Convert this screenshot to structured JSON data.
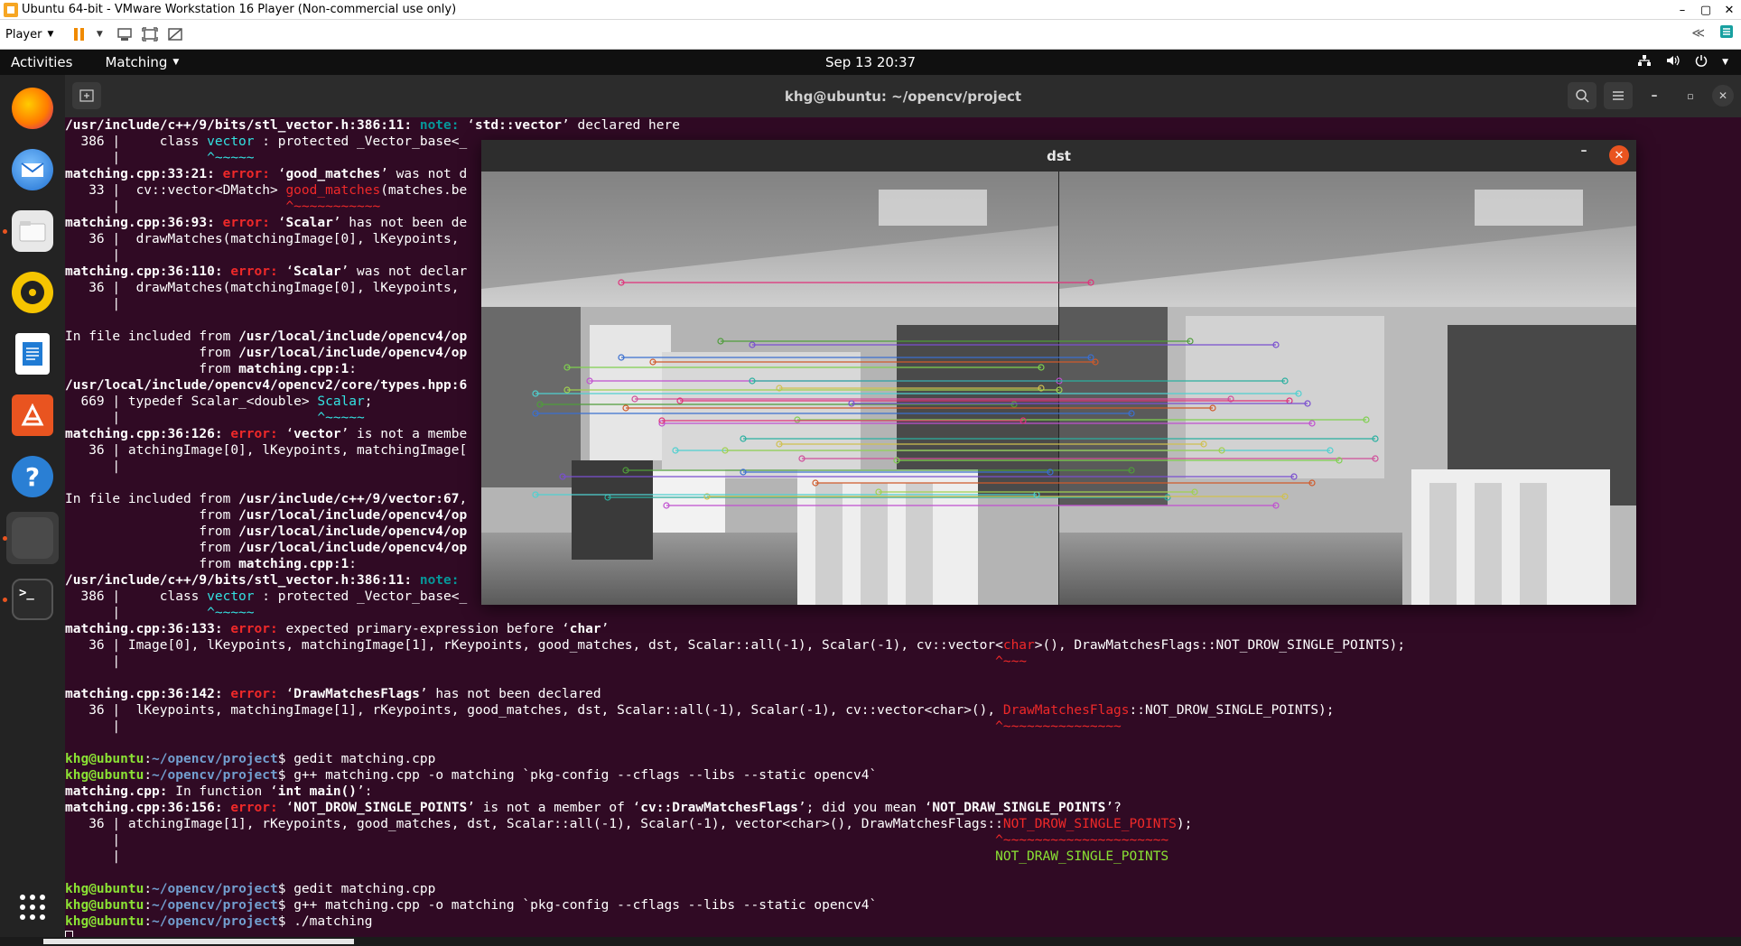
{
  "vm_window": {
    "title": "Ubuntu 64-bit - VMware Workstation 16 Player (Non-commercial use only)",
    "controls": {
      "minimize": "–",
      "restore": "▢",
      "close": "✕"
    }
  },
  "vm_toolbar": {
    "player_label": "Player"
  },
  "topbar": {
    "activities": "Activities",
    "app_menu": "Matching",
    "clock": "Sep 13  20:37"
  },
  "dock": {
    "items": [
      {
        "name": "Firefox",
        "icon": "firefox-icon",
        "color": "#e66000"
      },
      {
        "name": "Thunderbird",
        "icon": "thunderbird-icon",
        "color": "#2a7fd4"
      },
      {
        "name": "Files",
        "icon": "files-icon",
        "color": "#d6d6d6"
      },
      {
        "name": "Rhythmbox",
        "icon": "rhythmbox-icon",
        "color": "#f5c400"
      },
      {
        "name": "LibreOffice Writer",
        "icon": "writer-icon",
        "color": "#1f7bd4"
      },
      {
        "name": "Ubuntu Software",
        "icon": "software-icon",
        "color": "#e95420"
      },
      {
        "name": "Help",
        "icon": "help-icon",
        "color": "#2a7fd4"
      },
      {
        "name": "Matching",
        "icon": "matching-app-icon",
        "color": "#3c3c3c"
      },
      {
        "name": "Terminal",
        "icon": "terminal-icon",
        "color": "#2c2c2c"
      }
    ],
    "show_apps": "show-applications-icon"
  },
  "terminal": {
    "title": "khg@ubuntu: ~/opencv/project",
    "lines": [
      [
        {
          "t": "/usr/include/c++/9/bits/stl_vector.h:386:11: ",
          "c": "b"
        },
        {
          "t": "note: ",
          "c": "note"
        },
        {
          "t": "‘",
          "c": ""
        },
        {
          "t": "std::vector",
          "c": "b"
        },
        {
          "t": "’ declared here",
          "c": ""
        }
      ],
      [
        {
          "t": "  386 |     class ",
          "c": ""
        },
        {
          "t": "vector",
          "c": "cy"
        },
        {
          "t": " : protected _Vector_base<_",
          "c": ""
        }
      ],
      [
        {
          "t": "      |           ",
          "c": ""
        },
        {
          "t": "^~~~~~",
          "c": "cy"
        }
      ],
      [
        {
          "t": "matching.cpp:33:21: ",
          "c": "b"
        },
        {
          "t": "error: ",
          "c": "err"
        },
        {
          "t": "‘",
          "c": ""
        },
        {
          "t": "good_matches",
          "c": "b"
        },
        {
          "t": "’ was not d",
          "c": ""
        }
      ],
      [
        {
          "t": "   33 |  cv::vector<DMatch> ",
          "c": ""
        },
        {
          "t": "good_matches",
          "c": "red"
        },
        {
          "t": "(matches.be",
          "c": ""
        }
      ],
      [
        {
          "t": "      |                     ",
          "c": ""
        },
        {
          "t": "^~~~~~~~~~~~",
          "c": "red"
        }
      ],
      [
        {
          "t": "matching.cpp:36:93: ",
          "c": "b"
        },
        {
          "t": "error: ",
          "c": "err"
        },
        {
          "t": "‘",
          "c": ""
        },
        {
          "t": "Scalar",
          "c": "b"
        },
        {
          "t": "’ has not been de",
          "c": ""
        }
      ],
      [
        {
          "t": "   36 |  drawMatches(matchingImage[0], lKeypoints,",
          "c": ""
        }
      ],
      [
        {
          "t": "      |",
          "c": ""
        }
      ],
      [
        {
          "t": "matching.cpp:36:110: ",
          "c": "b"
        },
        {
          "t": "error: ",
          "c": "err"
        },
        {
          "t": "‘",
          "c": ""
        },
        {
          "t": "Scalar",
          "c": "b"
        },
        {
          "t": "’ was not declar",
          "c": ""
        }
      ],
      [
        {
          "t": "   36 |  drawMatches(matchingImage[0], lKeypoints,",
          "c": ""
        }
      ],
      [
        {
          "t": "      |",
          "c": ""
        }
      ],
      [
        {
          "t": "",
          "c": ""
        }
      ],
      [
        {
          "t": "In file included from ",
          "c": ""
        },
        {
          "t": "/usr/local/include/opencv4/op",
          "c": "b"
        }
      ],
      [
        {
          "t": "                 from ",
          "c": ""
        },
        {
          "t": "/usr/local/include/opencv4/op",
          "c": "b"
        }
      ],
      [
        {
          "t": "                 from ",
          "c": ""
        },
        {
          "t": "matching.cpp:1",
          "c": "b"
        },
        {
          "t": ":",
          "c": ""
        }
      ],
      [
        {
          "t": "/usr/local/include/opencv4/opencv2/core/types.hpp:6",
          "c": "b"
        }
      ],
      [
        {
          "t": "  669 | typedef Scalar_<double> ",
          "c": ""
        },
        {
          "t": "Scalar",
          "c": "cy"
        },
        {
          "t": ";",
          "c": ""
        }
      ],
      [
        {
          "t": "      |                         ",
          "c": ""
        },
        {
          "t": "^~~~~~",
          "c": "cy"
        }
      ],
      [
        {
          "t": "matching.cpp:36:126: ",
          "c": "b"
        },
        {
          "t": "error: ",
          "c": "err"
        },
        {
          "t": "‘",
          "c": ""
        },
        {
          "t": "vector",
          "c": "b"
        },
        {
          "t": "’ is not a membe",
          "c": ""
        }
      ],
      [
        {
          "t": "   36 | atchingImage[0], lKeypoints, matchingImage[",
          "c": ""
        }
      ],
      [
        {
          "t": "      |",
          "c": ""
        }
      ],
      [
        {
          "t": "",
          "c": ""
        }
      ],
      [
        {
          "t": "In file included from ",
          "c": ""
        },
        {
          "t": "/usr/include/c++/9/vector:67",
          "c": "b"
        },
        {
          "t": ",",
          "c": ""
        }
      ],
      [
        {
          "t": "                 from ",
          "c": ""
        },
        {
          "t": "/usr/local/include/opencv4/op",
          "c": "b"
        }
      ],
      [
        {
          "t": "                 from ",
          "c": ""
        },
        {
          "t": "/usr/local/include/opencv4/op",
          "c": "b"
        }
      ],
      [
        {
          "t": "                 from ",
          "c": ""
        },
        {
          "t": "/usr/local/include/opencv4/op",
          "c": "b"
        }
      ],
      [
        {
          "t": "                 from ",
          "c": ""
        },
        {
          "t": "matching.cpp:1",
          "c": "b"
        },
        {
          "t": ":",
          "c": ""
        }
      ],
      [
        {
          "t": "/usr/include/c++/9/bits/stl_vector.h:386:11: ",
          "c": "b"
        },
        {
          "t": "note: ",
          "c": "note"
        }
      ],
      [
        {
          "t": "  386 |     class ",
          "c": ""
        },
        {
          "t": "vector",
          "c": "cy"
        },
        {
          "t": " : protected _Vector_base<_",
          "c": ""
        }
      ],
      [
        {
          "t": "      |           ",
          "c": ""
        },
        {
          "t": "^~~~~~",
          "c": "cy"
        }
      ],
      [
        {
          "t": "matching.cpp:36:133: ",
          "c": "b"
        },
        {
          "t": "error: ",
          "c": "err"
        },
        {
          "t": "expected primary-expression before ‘",
          "c": ""
        },
        {
          "t": "char",
          "c": "b"
        },
        {
          "t": "’",
          "c": ""
        }
      ],
      [
        {
          "t": "   36 | Image[0], lKeypoints, matchingImage[1], rKeypoints, good_matches, dst, Scalar::all(-1), Scalar(-1), cv::vector<",
          "c": ""
        },
        {
          "t": "char",
          "c": "red"
        },
        {
          "t": ">(), DrawMatchesFlags::NOT_DROW_SINGLE_POINTS);",
          "c": ""
        }
      ],
      [
        {
          "t": "      |                                                                                                               ",
          "c": ""
        },
        {
          "t": "^~~~",
          "c": "red"
        }
      ],
      [
        {
          "t": "",
          "c": ""
        }
      ],
      [
        {
          "t": "matching.cpp:36:142: ",
          "c": "b"
        },
        {
          "t": "error: ",
          "c": "err"
        },
        {
          "t": "‘",
          "c": ""
        },
        {
          "t": "DrawMatchesFlags",
          "c": "b"
        },
        {
          "t": "’ has not been declared",
          "c": ""
        }
      ],
      [
        {
          "t": "   36 |  lKeypoints, matchingImage[1], rKeypoints, good_matches, dst, Scalar::all(-1), Scalar(-1), cv::vector<char>(), ",
          "c": ""
        },
        {
          "t": "DrawMatchesFlags",
          "c": "red"
        },
        {
          "t": "::NOT_DROW_SINGLE_POINTS);",
          "c": ""
        }
      ],
      [
        {
          "t": "      |                                                                                                               ",
          "c": ""
        },
        {
          "t": "^~~~~~~~~~~~~~~~",
          "c": "red"
        }
      ],
      [
        {
          "t": "",
          "c": ""
        }
      ],
      [
        {
          "t": "khg@ubuntu",
          "c": "prompt-u"
        },
        {
          "t": ":",
          "c": ""
        },
        {
          "t": "~/opencv/project",
          "c": "prompt-p"
        },
        {
          "t": "$ gedit matching.cpp",
          "c": ""
        }
      ],
      [
        {
          "t": "khg@ubuntu",
          "c": "prompt-u"
        },
        {
          "t": ":",
          "c": ""
        },
        {
          "t": "~/opencv/project",
          "c": "prompt-p"
        },
        {
          "t": "$ g++ matching.cpp -o matching `pkg-config --cflags --libs --static opencv4`",
          "c": ""
        }
      ],
      [
        {
          "t": "matching.cpp:",
          "c": "b"
        },
        {
          "t": " In function ‘",
          "c": ""
        },
        {
          "t": "int main()",
          "c": "b"
        },
        {
          "t": "’:",
          "c": ""
        }
      ],
      [
        {
          "t": "matching.cpp:36:156: ",
          "c": "b"
        },
        {
          "t": "error: ",
          "c": "err"
        },
        {
          "t": "‘",
          "c": ""
        },
        {
          "t": "NOT_DROW_SINGLE_POINTS",
          "c": "b"
        },
        {
          "t": "’ is not a member of ‘",
          "c": ""
        },
        {
          "t": "cv::DrawMatchesFlags",
          "c": "b"
        },
        {
          "t": "’; did you mean ‘",
          "c": ""
        },
        {
          "t": "NOT_DRAW_SINGLE_POINTS",
          "c": "b"
        },
        {
          "t": "’?",
          "c": ""
        }
      ],
      [
        {
          "t": "   36 | atchingImage[1], rKeypoints, good_matches, dst, Scalar::all(-1), Scalar(-1), vector<char>(), DrawMatchesFlags::",
          "c": ""
        },
        {
          "t": "NOT_DROW_SINGLE_POINTS",
          "c": "red"
        },
        {
          "t": ");",
          "c": ""
        }
      ],
      [
        {
          "t": "      |                                                                                                               ",
          "c": ""
        },
        {
          "t": "^~~~~~~~~~~~~~~~~~~~~~",
          "c": "red"
        }
      ],
      [
        {
          "t": "      |                                                                                                               ",
          "c": ""
        },
        {
          "t": "NOT_DRAW_SINGLE_POINTS",
          "c": "grn"
        }
      ],
      [
        {
          "t": "",
          "c": ""
        }
      ],
      [
        {
          "t": "khg@ubuntu",
          "c": "prompt-u"
        },
        {
          "t": ":",
          "c": ""
        },
        {
          "t": "~/opencv/project",
          "c": "prompt-p"
        },
        {
          "t": "$ gedit matching.cpp",
          "c": ""
        }
      ],
      [
        {
          "t": "khg@ubuntu",
          "c": "prompt-u"
        },
        {
          "t": ":",
          "c": ""
        },
        {
          "t": "~/opencv/project",
          "c": "prompt-p"
        },
        {
          "t": "$ g++ matching.cpp -o matching `pkg-config --cflags --libs --static opencv4`",
          "c": ""
        }
      ],
      [
        {
          "t": "khg@ubuntu",
          "c": "prompt-u"
        },
        {
          "t": ":",
          "c": ""
        },
        {
          "t": "~/opencv/project",
          "c": "prompt-p"
        },
        {
          "t": "$ ./matching",
          "c": ""
        }
      ]
    ]
  },
  "dst_window": {
    "title": "dst",
    "minimize": "–",
    "close": "✕",
    "match_colors": [
      "#e0307a",
      "#4f9d3b",
      "#7a4fd0",
      "#3b6fd0",
      "#d05a2a",
      "#7fd04f",
      "#c04fd0",
      "#2ab0a0",
      "#d0c04f",
      "#4fd0d0",
      "#a0d04f",
      "#d04f9a"
    ]
  }
}
